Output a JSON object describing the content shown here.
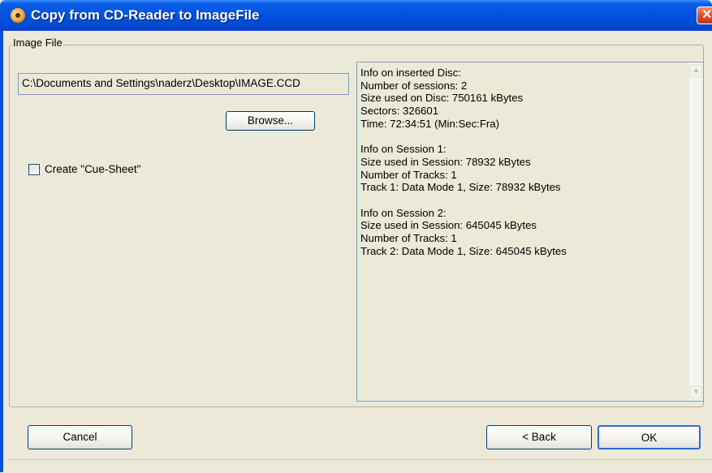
{
  "window": {
    "title": "Copy from CD-Reader to ImageFile",
    "close_glyph": "✕"
  },
  "group": {
    "label": "Image File"
  },
  "path_field": {
    "value": "C:\\Documents and Settings\\naderz\\Desktop\\IMAGE.CCD"
  },
  "buttons": {
    "browse": "Browse...",
    "cancel": "Cancel",
    "back": "< Back",
    "ok": "OK"
  },
  "checkbox": {
    "label": "Create \"Cue-Sheet\"",
    "checked": false
  },
  "info": {
    "lines": [
      "Info on inserted Disc:",
      "Number of sessions: 2",
      "Size used on Disc: 750161 kBytes",
      "Sectors: 326601",
      "Time: 72:34:51 (Min:Sec:Fra)",
      "",
      "Info on Session 1:",
      "Size used in Session: 78932 kBytes",
      "Number of Tracks: 1",
      "Track 1: Data Mode 1, Size: 78932 kBytes",
      "",
      "Info on Session 2:",
      "Size used in Session: 645045 kBytes",
      "Number of Tracks: 1",
      "Track 2: Data Mode 1, Size: 645045 kBytes"
    ],
    "scroll_up_glyph": "▲",
    "scroll_down_glyph": "▼"
  },
  "icons": {
    "app": "cd-copy-icon",
    "close": "close-icon"
  },
  "colors": {
    "titlebar": "#0251dc",
    "dialog_bg": "#ece9d8",
    "close": "#d8452a"
  }
}
